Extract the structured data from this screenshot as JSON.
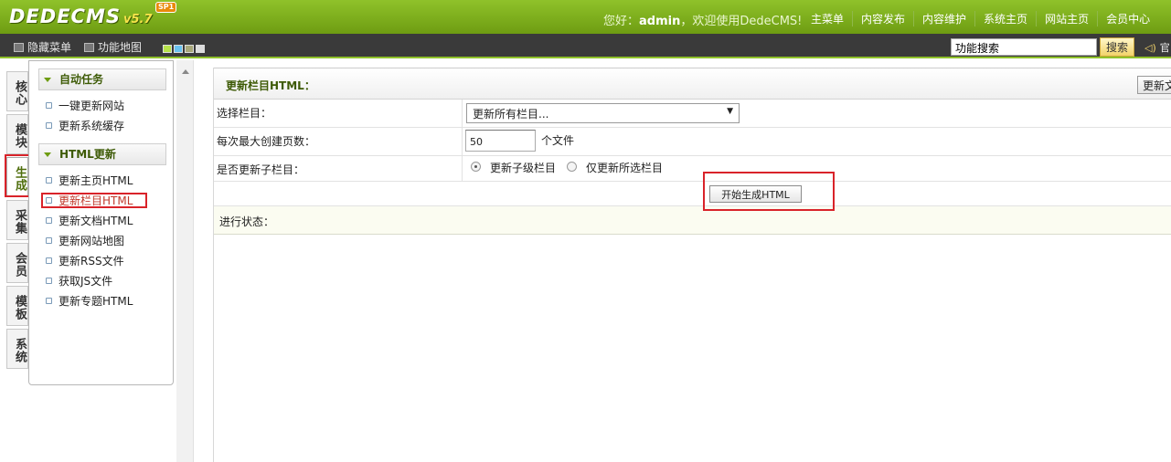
{
  "header": {
    "logo_word": "DEDECMS",
    "logo_version": "v5.7",
    "logo_badge": "SP1",
    "welcome_prefix": "您好：",
    "welcome_user": "admin",
    "welcome_suffix": "，欢迎使用DedeCMS!",
    "nav": [
      "主菜单",
      "内容发布",
      "内容维护",
      "系统主页",
      "网站主页",
      "会员中心"
    ]
  },
  "toolbar": {
    "hide_menu": "隐藏菜单",
    "func_map": "功能地图",
    "swatch_colors": [
      "#b7e34a",
      "#6bc3f0",
      "#a8a87a",
      "#dcdcdc"
    ],
    "search_value": "功能搜索",
    "search_btn": "搜索",
    "sound_label": "官"
  },
  "vtabs": [
    {
      "label": "核心",
      "active": false
    },
    {
      "label": "模块",
      "active": false
    },
    {
      "label": "生成",
      "active": true
    },
    {
      "label": "采集",
      "active": false
    },
    {
      "label": "会员",
      "active": false
    },
    {
      "label": "模板",
      "active": false
    },
    {
      "label": "系统",
      "active": false
    }
  ],
  "sidebar": {
    "group1": "自动任务",
    "group1_items": [
      "一键更新网站",
      "更新系统缓存"
    ],
    "group2": "HTML更新",
    "group2_items": [
      "更新主页HTML",
      "更新栏目HTML",
      "更新文档HTML",
      "更新网站地图",
      "更新RSS文件",
      "获取JS文件",
      "更新专题HTML"
    ]
  },
  "form": {
    "title": "更新栏目HTML：",
    "head_button": "更新文",
    "select_label": "选择栏目：",
    "select_value": "更新所有栏目...",
    "maxpage_label": "每次最大创建页数：",
    "maxpage_value": "50",
    "maxpage_unit": "个文件",
    "sub_label": "是否更新子栏目：",
    "radio1": "更新子级栏目",
    "radio2": "仅更新所选栏目",
    "start_button": "开始生成HTML",
    "status_label": "进行状态："
  },
  "colors": {
    "header_green": "#7fb01e",
    "toolbar_dark": "#3a3a3a",
    "highlight_red": "#d9232a",
    "title_green": "#3d5a05"
  }
}
